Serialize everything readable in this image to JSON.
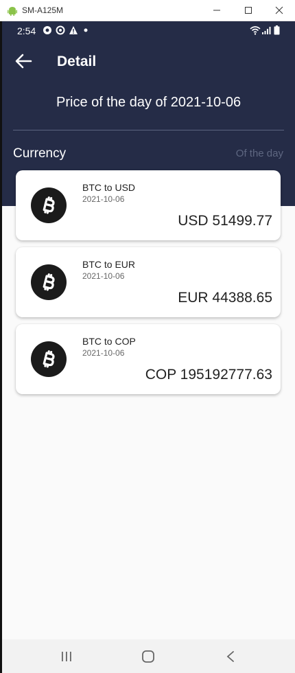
{
  "window": {
    "title": "SM-A125M"
  },
  "status_bar": {
    "time": "2:54"
  },
  "app_bar": {
    "title": "Detail"
  },
  "header": {
    "subtitle": "Price of the day of 2021-10-06",
    "currency_label": "Currency",
    "of_the_day_label": "Of the day"
  },
  "cards": [
    {
      "icon": "bitcoin-icon",
      "pair": "BTC to USD",
      "date": "2021-10-06",
      "amount": "USD 51499.77"
    },
    {
      "icon": "bitcoin-icon",
      "pair": "BTC to EUR",
      "date": "2021-10-06",
      "amount": "EUR 44388.65"
    },
    {
      "icon": "bitcoin-icon",
      "pair": "BTC to COP",
      "date": "2021-10-06",
      "amount": "COP 195192777.63"
    }
  ],
  "colors": {
    "header_bg": "#252c47",
    "content_bg": "#fafafa",
    "coin_bg": "#1b1b1b"
  }
}
